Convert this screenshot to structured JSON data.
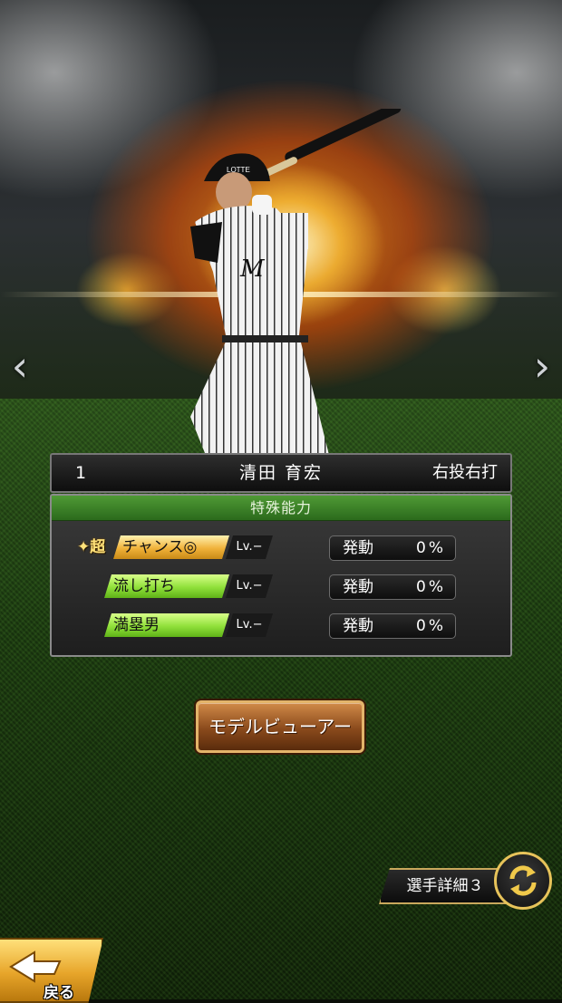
{
  "player": {
    "number": "1",
    "name": "清田 育宏",
    "handedness": "右投右打",
    "helmet_text": "LOTTE"
  },
  "abilities": {
    "title": "特殊能力",
    "super_mark": "超",
    "items": [
      {
        "label": "チャンス◎",
        "level": "Lv.−",
        "activation_label": "発動",
        "activation_value": "0%",
        "rank": "super",
        "color": "#f0b23a"
      },
      {
        "label": "流し打ち",
        "level": "Lv.−",
        "activation_label": "発動",
        "activation_value": "0%",
        "rank": "normal",
        "color": "#90e03a"
      },
      {
        "label": "満塁男",
        "level": "Lv.−",
        "activation_label": "発動",
        "activation_value": "0%",
        "rank": "normal",
        "color": "#90e03a"
      }
    ]
  },
  "buttons": {
    "model_viewer": "モデルビューアー",
    "player_detail": "選手詳細３",
    "back": "戻る"
  },
  "navigation": {
    "prev_icon": "chevron-left-icon",
    "next_icon": "chevron-right-icon",
    "switch_icon": "refresh-arrows-icon",
    "back_icon": "arrow-left-icon"
  },
  "colors": {
    "accent_gold": "#e7c35a",
    "panel_green": "#3f8a2a",
    "button_brown": "#8a4a1c"
  }
}
